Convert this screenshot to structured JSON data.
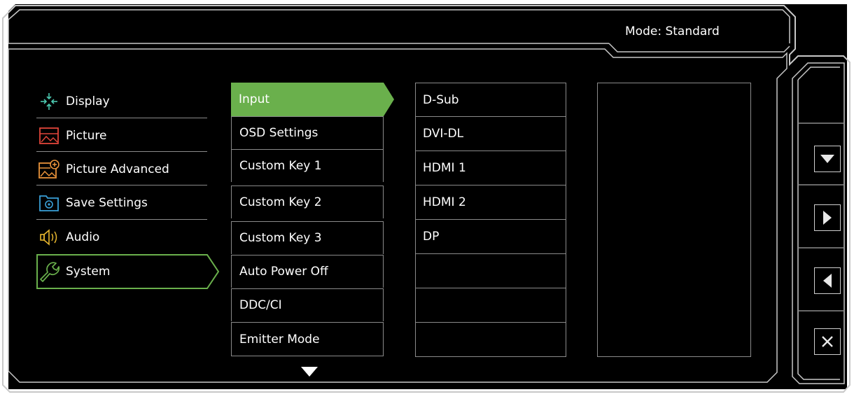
{
  "header": {
    "mode_text": "Mode: Standard"
  },
  "categories": [
    {
      "label": "Display",
      "icon": "display-icon"
    },
    {
      "label": "Picture",
      "icon": "picture-icon"
    },
    {
      "label": "Picture Advanced",
      "icon": "picture-advanced-icon"
    },
    {
      "label": "Save Settings",
      "icon": "save-settings-icon"
    },
    {
      "label": "Audio",
      "icon": "audio-icon"
    },
    {
      "label": "System",
      "icon": "wrench-icon",
      "selected": true
    }
  ],
  "submenu": [
    {
      "label": "Input",
      "selected": true
    },
    {
      "label": "OSD Settings"
    },
    {
      "label": "Custom Key 1"
    },
    {
      "label": "Custom Key 2"
    },
    {
      "label": "Custom Key 3"
    },
    {
      "label": "Auto Power Off"
    },
    {
      "label": "DDC/CI"
    },
    {
      "label": "Emitter Mode"
    }
  ],
  "options": [
    "D-Sub",
    "DVI-DL",
    "HDMI 1",
    "HDMI 2",
    "DP",
    "",
    "",
    ""
  ],
  "side_buttons": [
    "down-button",
    "right-button",
    "left-button",
    "close-button"
  ],
  "colors": {
    "background": "#000000",
    "accent": "#6ab04c",
    "divider": "#8a8a8a",
    "frame": "#c8c8c8"
  }
}
